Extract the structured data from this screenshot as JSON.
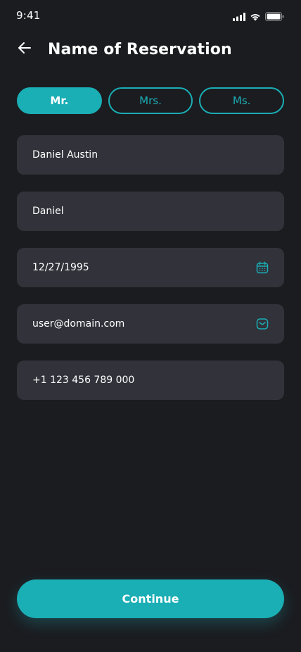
{
  "status_bar": {
    "time": "9:41"
  },
  "header": {
    "title": "Name of Reservation"
  },
  "title_options": {
    "items": [
      {
        "label": "Mr.",
        "selected": true
      },
      {
        "label": "Mrs.",
        "selected": false
      },
      {
        "label": "Ms.",
        "selected": false
      }
    ]
  },
  "form": {
    "full_name": "Daniel Austin",
    "nickname": "Daniel",
    "date_of_birth": "12/27/1995",
    "email": "user@domain.com",
    "phone": "+1 123 456 789 000"
  },
  "icons": {
    "back": "arrow-left-icon",
    "calendar": "calendar-icon",
    "email": "mail-icon"
  },
  "colors": {
    "background": "#1b1c20",
    "field": "#31323a",
    "accent": "#1aaeb5",
    "text": "#ffffff"
  },
  "actions": {
    "continue_label": "Continue"
  }
}
